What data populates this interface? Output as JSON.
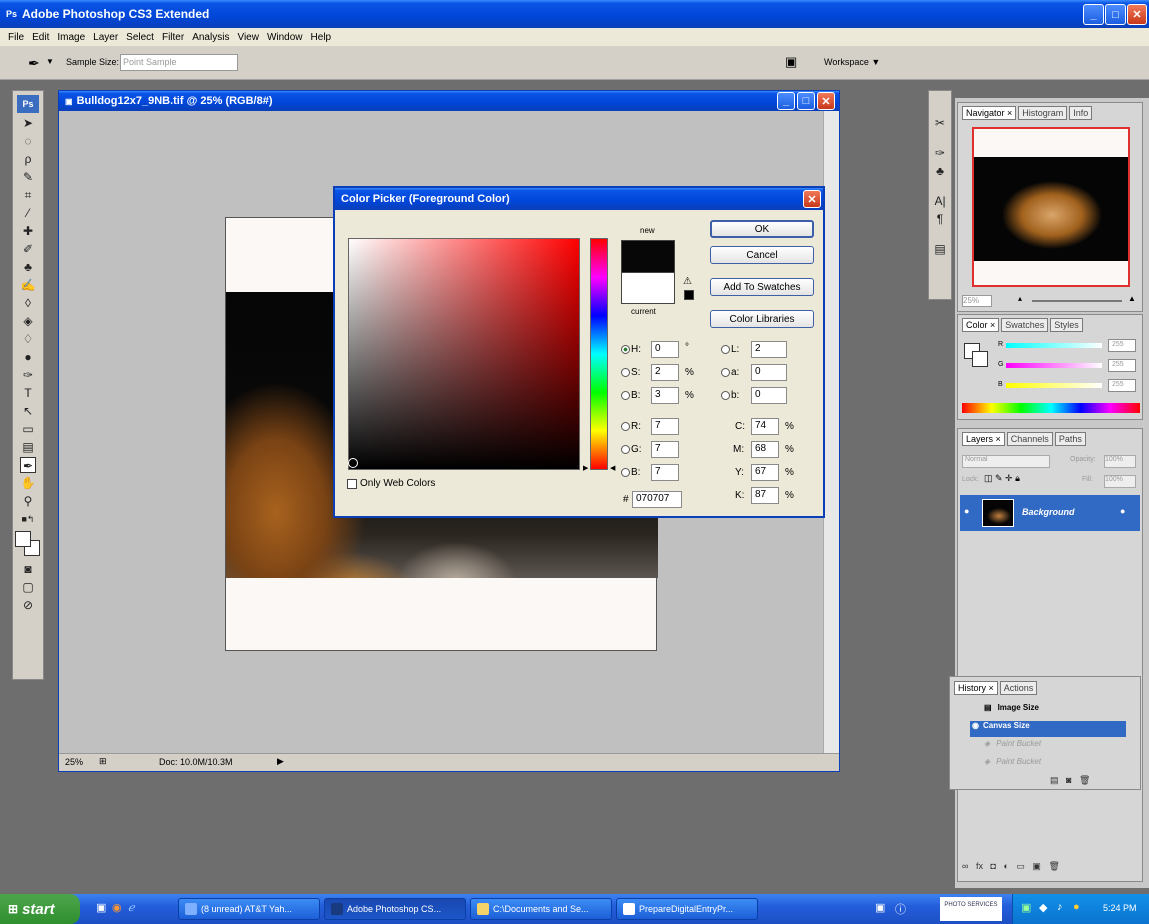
{
  "app": {
    "title": "Adobe Photoshop CS3 Extended",
    "menu": [
      "File",
      "Edit",
      "Image",
      "Layer",
      "Select",
      "Filter",
      "Analysis",
      "View",
      "Window",
      "Help"
    ],
    "options": {
      "sample_size_label": "Sample Size:",
      "sample_size_value": "Point Sample",
      "workspace_label": "Workspace ▼"
    }
  },
  "document": {
    "title": "Bulldog12x7_9NB.tif @ 25% (RGB/8#)",
    "status": {
      "zoom": "25%",
      "doc": "Doc: 10.0M/10.3M"
    }
  },
  "color_picker": {
    "title": "Color Picker (Foreground Color)",
    "new_label": "new",
    "current_label": "current",
    "buttons": {
      "ok": "OK",
      "cancel": "Cancel",
      "add_to_swatches": "Add To Swatches",
      "color_libraries": "Color Libraries"
    },
    "only_web_colors": "Only Web Colors",
    "hsb": {
      "h_label": "H:",
      "h": "0",
      "h_unit": "°",
      "s_label": "S:",
      "s": "2",
      "s_unit": "%",
      "b_label": "B:",
      "b": "3",
      "b_unit": "%"
    },
    "rgb": {
      "r_label": "R:",
      "r": "7",
      "g_label": "G:",
      "g": "7",
      "b_label": "B:",
      "b": "7"
    },
    "hex_label": "#",
    "hex": "070707",
    "lab": {
      "l_label": "L:",
      "l": "2",
      "a_label": "a:",
      "a": "0",
      "b_label": "b:",
      "b": "0"
    },
    "cmyk": {
      "c_label": "C:",
      "c": "74",
      "m_label": "M:",
      "m": "68",
      "y_label": "Y:",
      "y": "67",
      "k_label": "K:",
      "k": "87",
      "unit": "%"
    },
    "colors": {
      "new_swatch": "#070707",
      "current_swatch": "#ffffff",
      "hue_base": "#ff0000"
    }
  },
  "panels": {
    "navigator": {
      "tabs": [
        "Navigator ×",
        "Histogram",
        "Info"
      ],
      "zoom": "25%"
    },
    "color": {
      "tabs": [
        "Color ×",
        "Swatches",
        "Styles"
      ],
      "r_label": "R",
      "g_label": "G",
      "b_label": "B",
      "r": "255",
      "g": "255",
      "b": "255"
    },
    "layers": {
      "tabs": [
        "Layers ×",
        "Channels",
        "Paths"
      ],
      "blend": "Normal",
      "opacity_label": "Opacity:",
      "opacity": "100%",
      "lock_label": "Lock:",
      "fill_label": "Fill:",
      "fill": "100%",
      "layer_name": "Background"
    },
    "history": {
      "tabs": [
        "History ×",
        "Actions"
      ],
      "items": [
        "Image Size",
        "Canvas Size",
        "Paint Bucket",
        "Paint Bucket"
      ]
    }
  },
  "taskbar": {
    "start": "start",
    "buttons": [
      "(8 unread) AT&T Yah...",
      "Adobe Photoshop CS...",
      "C:\\Documents and Se...",
      "PrepareDigitalEntryPr..."
    ],
    "tray_box": "PHOTO SERVICES",
    "clock": "5:24 PM"
  }
}
